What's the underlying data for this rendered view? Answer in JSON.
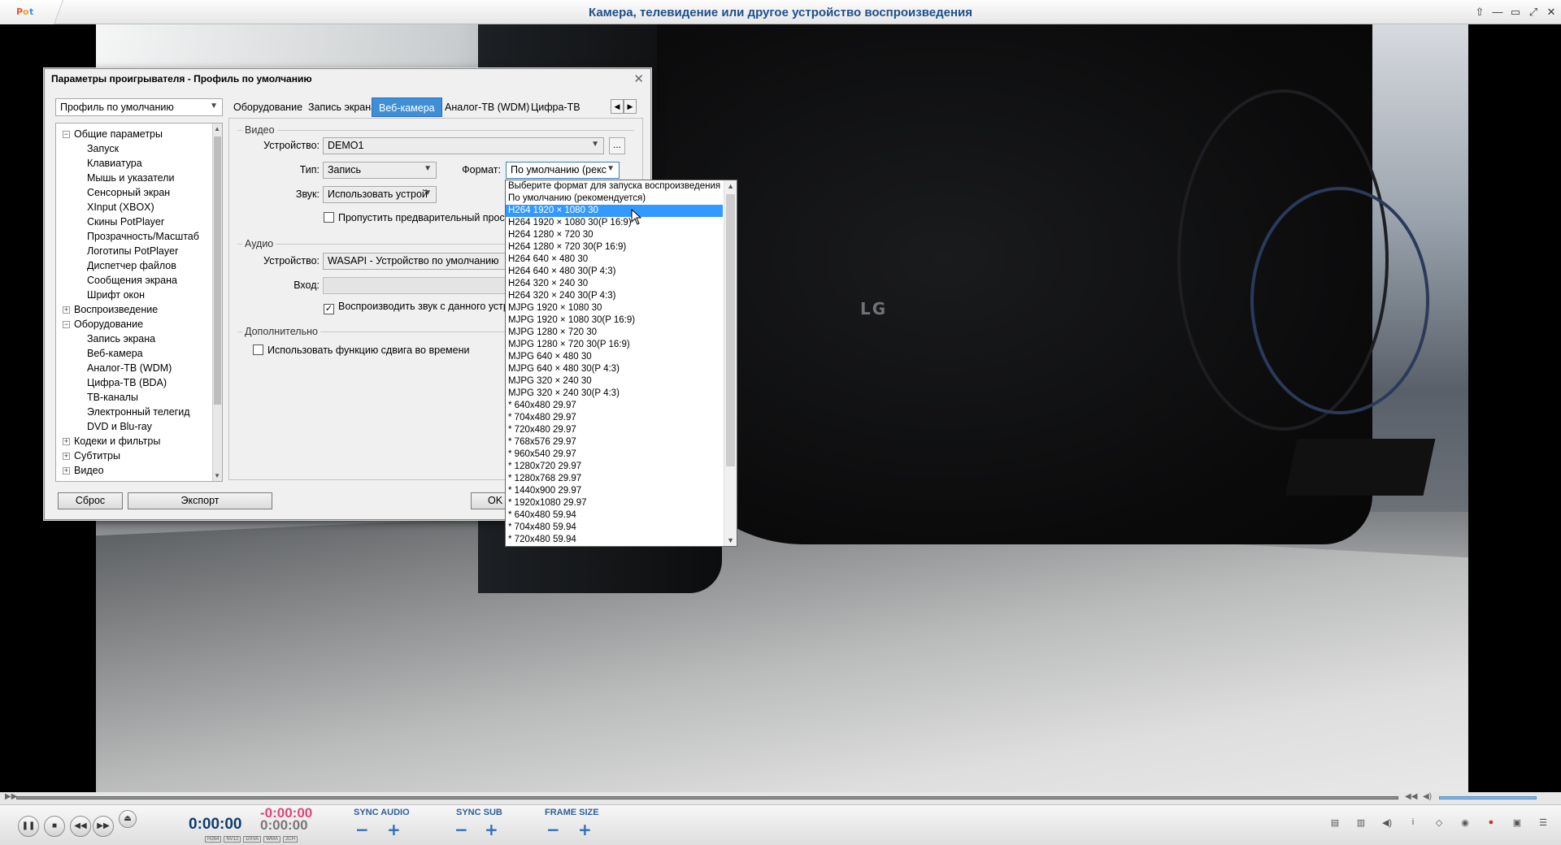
{
  "window": {
    "title": "Камера, телевидение или другое устройство воспроизведения",
    "logo": "PotPlayer"
  },
  "video": {
    "overlay_text": "LG"
  },
  "dialog": {
    "title": "Параметры проигрывателя - Профиль по умолчанию",
    "profile": "Профиль по умолчанию",
    "tree": [
      {
        "label": "Общие параметры",
        "expander": "−"
      },
      {
        "label": "Запуск"
      },
      {
        "label": "Клавиатура"
      },
      {
        "label": "Мышь и указатели"
      },
      {
        "label": "Сенсорный экран"
      },
      {
        "label": "XInput (XBOX)"
      },
      {
        "label": "Скины PotPlayer"
      },
      {
        "label": "Прозрачность/Масштаб"
      },
      {
        "label": "Логотипы PotPlayer"
      },
      {
        "label": "Диспетчер файлов"
      },
      {
        "label": "Сообщения экрана"
      },
      {
        "label": "Шрифт окон"
      },
      {
        "label": "Воспроизведение",
        "expander": "+"
      },
      {
        "label": "Оборудование",
        "expander": "−"
      },
      {
        "label": "Запись экрана"
      },
      {
        "label": "Веб-камера"
      },
      {
        "label": "Аналог-ТВ (WDM)"
      },
      {
        "label": "Цифра-ТВ (BDA)"
      },
      {
        "label": "ТВ-каналы"
      },
      {
        "label": "Электронный телегид"
      },
      {
        "label": "DVD и Blu-ray"
      },
      {
        "label": "Кодеки и фильтры",
        "expander": "+"
      },
      {
        "label": "Субтитры",
        "expander": "+"
      },
      {
        "label": "Видео",
        "expander": "+"
      }
    ],
    "tabs": [
      "Оборудование",
      "Запись экрана",
      "Веб-камера",
      "Аналог-ТВ (WDM)",
      "Цифра-ТВ"
    ],
    "video_group": {
      "label": "Видео",
      "device_label": "Устройство:",
      "device_value": "DEMO1",
      "dots": "...",
      "type_label": "Тип:",
      "type_value": "Запись",
      "format_label": "Формат:",
      "format_value": "По умолчанию (рекс",
      "sound_label": "Звук:",
      "sound_value": "Использовать устрой",
      "skip_preview": "Пропустить предварительный просм"
    },
    "audio_group": {
      "label": "Аудио",
      "device_label": "Устройство:",
      "device_value": "WASAPI - Устройство по умолчанию",
      "input_label": "Вход:",
      "play_sound": "Воспроизводить звук с данного устрой"
    },
    "extra_group": {
      "label": "Дополнительно",
      "timeshift": "Использовать функцию сдвига во времени"
    },
    "buttons": {
      "reset": "Сброс",
      "export": "Экспорт",
      "ok": "OK"
    }
  },
  "format_dropdown": {
    "selected_index": 2,
    "items": [
      "Выберите формат для запуска воспроизведения",
      "По умолчанию (рекомендуется)",
      "H264 1920 × 1080 30",
      "H264 1920 × 1080 30(P 16:9)",
      "H264 1280 × 720 30",
      "H264 1280 × 720 30(P 16:9)",
      "H264 640 × 480 30",
      "H264 640 × 480 30(P 4:3)",
      "H264 320 × 240 30",
      "H264 320 × 240 30(P 4:3)",
      "MJPG 1920 × 1080 30",
      "MJPG 1920 × 1080 30(P 16:9)",
      "MJPG 1280 × 720 30",
      "MJPG 1280 × 720 30(P 16:9)",
      "MJPG 640 × 480 30",
      "MJPG 640 × 480 30(P 4:3)",
      "MJPG 320 × 240 30",
      "MJPG 320 × 240 30(P 4:3)",
      "* 640x480 29.97",
      "* 704x480 29.97",
      "* 720x480 29.97",
      "* 768x576 29.97",
      "* 960x540 29.97",
      "* 1280x720 29.97",
      "* 1280x768 29.97",
      "* 1440x900 29.97",
      "* 1920x1080 29.97",
      "* 640x480 59.94",
      "* 704x480 59.94",
      "* 720x480 59.94"
    ]
  },
  "controls": {
    "time_elapsed": "0:00:00",
    "time_remaining": "-0:00:00",
    "time_total": "0:00:00",
    "codecs": [
      "H264",
      "NV12",
      "DXVA",
      "WMA",
      "2CH"
    ],
    "sync_audio": "SYNC AUDIO",
    "sync_sub": "SYNC SUB",
    "frame_size": "FRAME SIZE",
    "minus": "−",
    "plus": "+"
  }
}
